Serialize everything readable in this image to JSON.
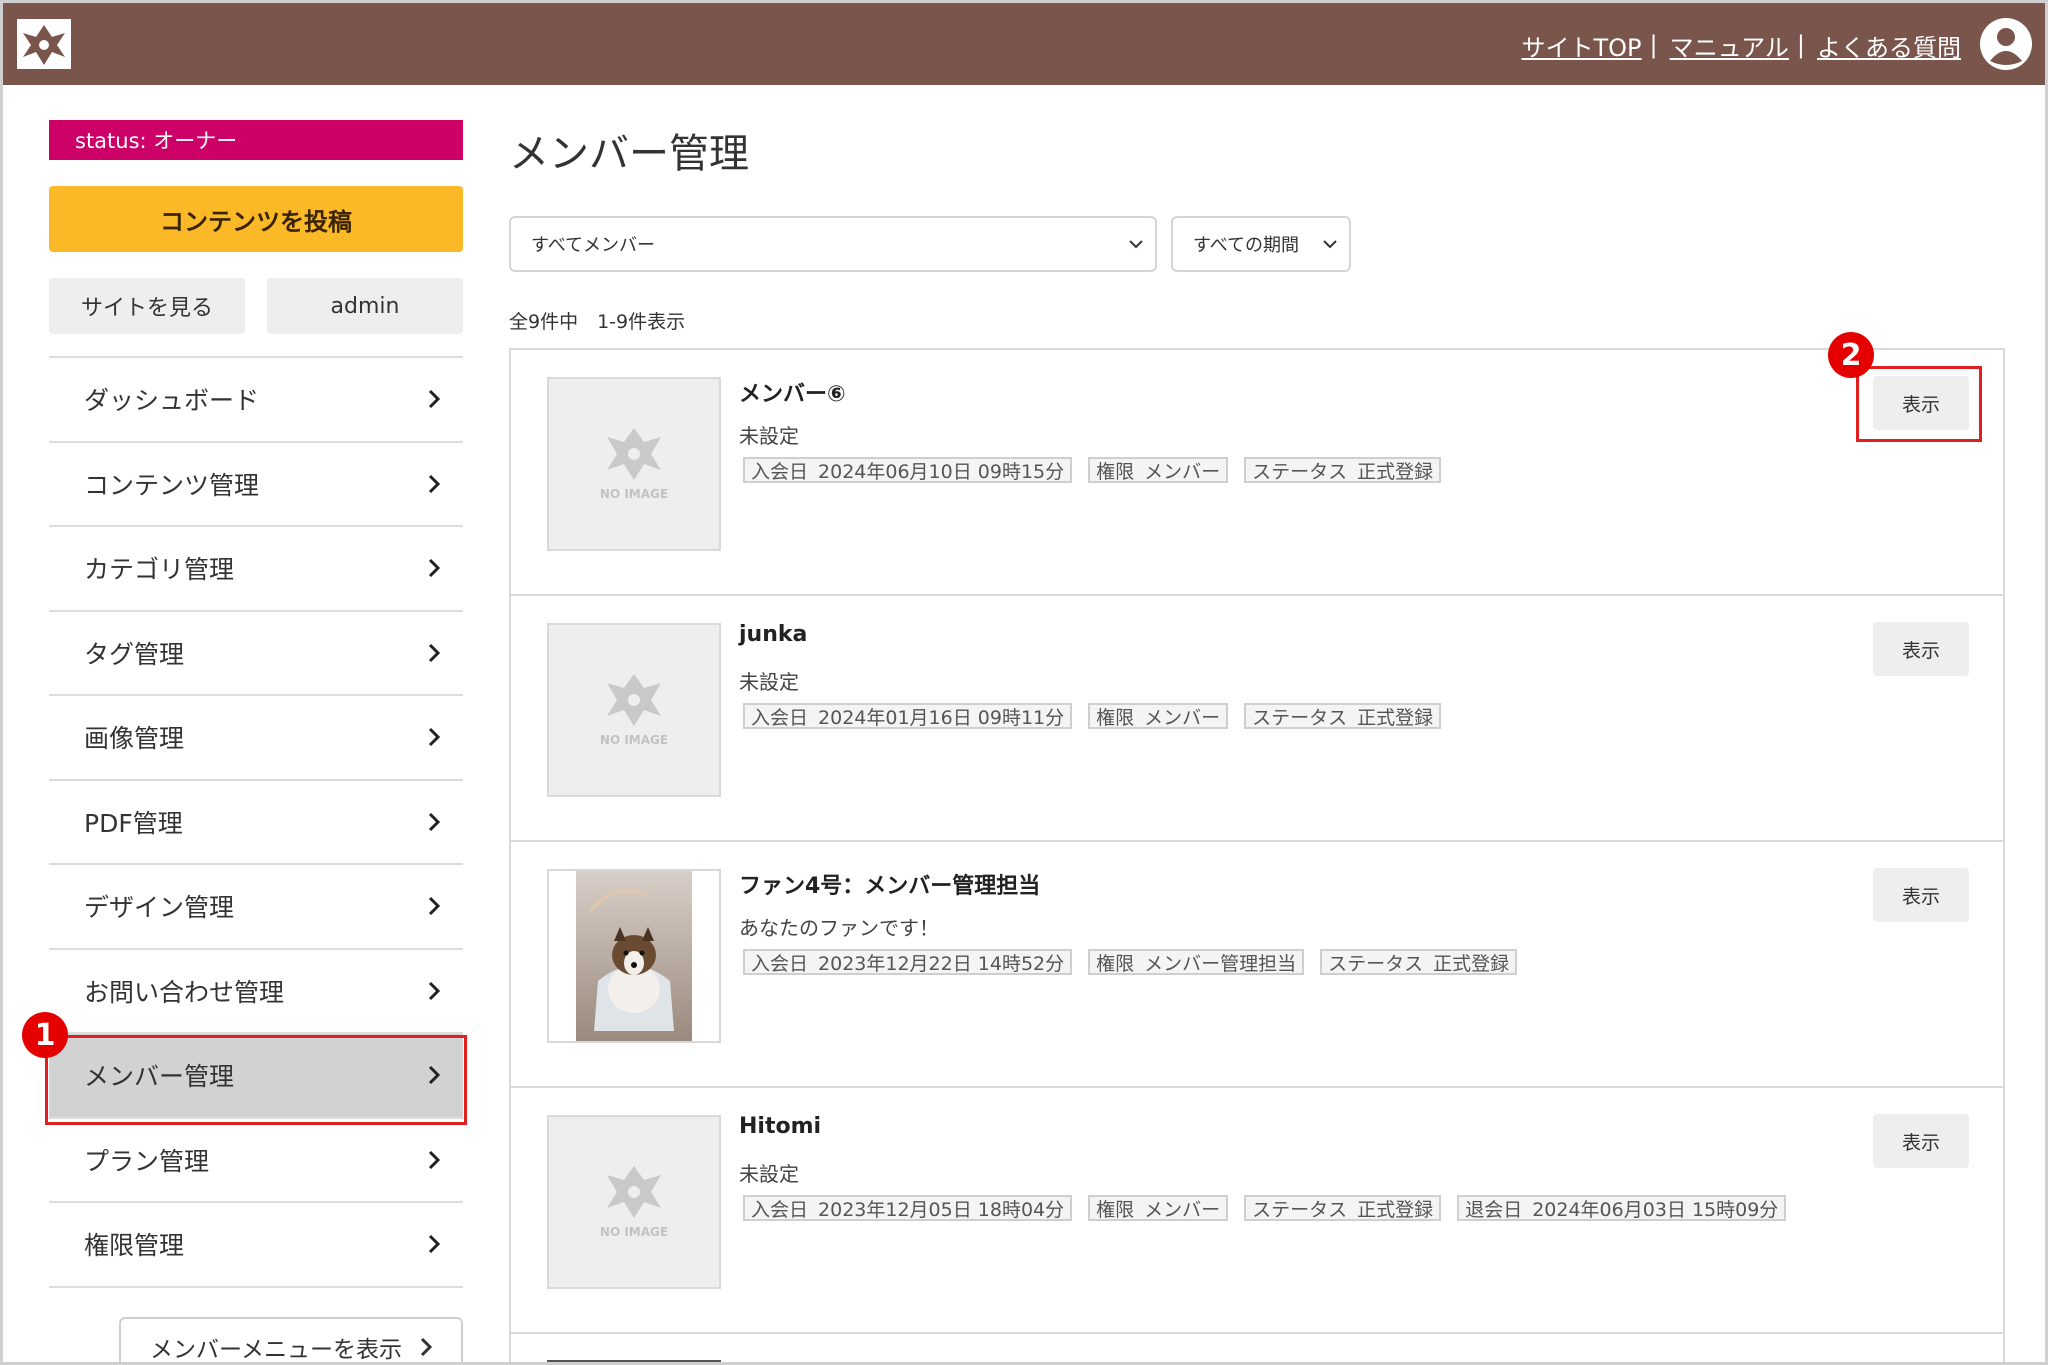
{
  "header": {
    "links": [
      "サイトTOP",
      "マニュアル",
      "よくある質問"
    ],
    "separator": "|"
  },
  "sidebar": {
    "status": "status: オーナー",
    "post_button": "コンテンツを投稿",
    "view_site_button": "サイトを見る",
    "admin_button": "admin",
    "nav": [
      "ダッシュボード",
      "コンテンツ管理",
      "カテゴリ管理",
      "タグ管理",
      "画像管理",
      "PDF管理",
      "デザイン管理",
      "お問い合わせ管理",
      "メンバー管理",
      "プラン管理",
      "権限管理"
    ],
    "active_item": "メンバー管理",
    "member_menu_button": "メンバーメニューを表示"
  },
  "main": {
    "title": "メンバー管理",
    "filter_member": "すべてメンバー",
    "filter_period": "すべての期間",
    "count_text": "全9件中　1-9件表示",
    "view_label": "表示",
    "members": [
      {
        "name": "メンバー⑥",
        "desc": "未設定",
        "thumb": "noimage",
        "tags": [
          {
            "k": "入会日",
            "v": "2024年06月10日 09時15分"
          },
          {
            "k": "権限",
            "v": "メンバー"
          },
          {
            "k": "ステータス",
            "v": "正式登録"
          }
        ]
      },
      {
        "name": "junka",
        "desc": "未設定",
        "thumb": "noimage",
        "tags": [
          {
            "k": "入会日",
            "v": "2024年01月16日 09時11分"
          },
          {
            "k": "権限",
            "v": "メンバー"
          },
          {
            "k": "ステータス",
            "v": "正式登録"
          }
        ]
      },
      {
        "name": "ファン4号：メンバー管理担当",
        "desc": "あなたのファンです！",
        "thumb": "photo",
        "tags": [
          {
            "k": "入会日",
            "v": "2023年12月22日 14時52分"
          },
          {
            "k": "権限",
            "v": "メンバー管理担当"
          },
          {
            "k": "ステータス",
            "v": "正式登録"
          }
        ]
      },
      {
        "name": "Hitomi",
        "desc": "未設定",
        "thumb": "noimage",
        "tags": [
          {
            "k": "入会日",
            "v": "2023年12月05日 18時04分"
          },
          {
            "k": "権限",
            "v": "メンバー"
          },
          {
            "k": "ステータス",
            "v": "正式登録"
          },
          {
            "k": "退会日",
            "v": "2024年06月03日 15時09分"
          }
        ]
      }
    ]
  },
  "annotations": [
    "1",
    "2"
  ],
  "noimage_text": "NO IMAGE",
  "colors": {
    "header": "#79554b",
    "status": "#cc0066",
    "post_button": "#fbb827",
    "highlight": "#e02020"
  }
}
